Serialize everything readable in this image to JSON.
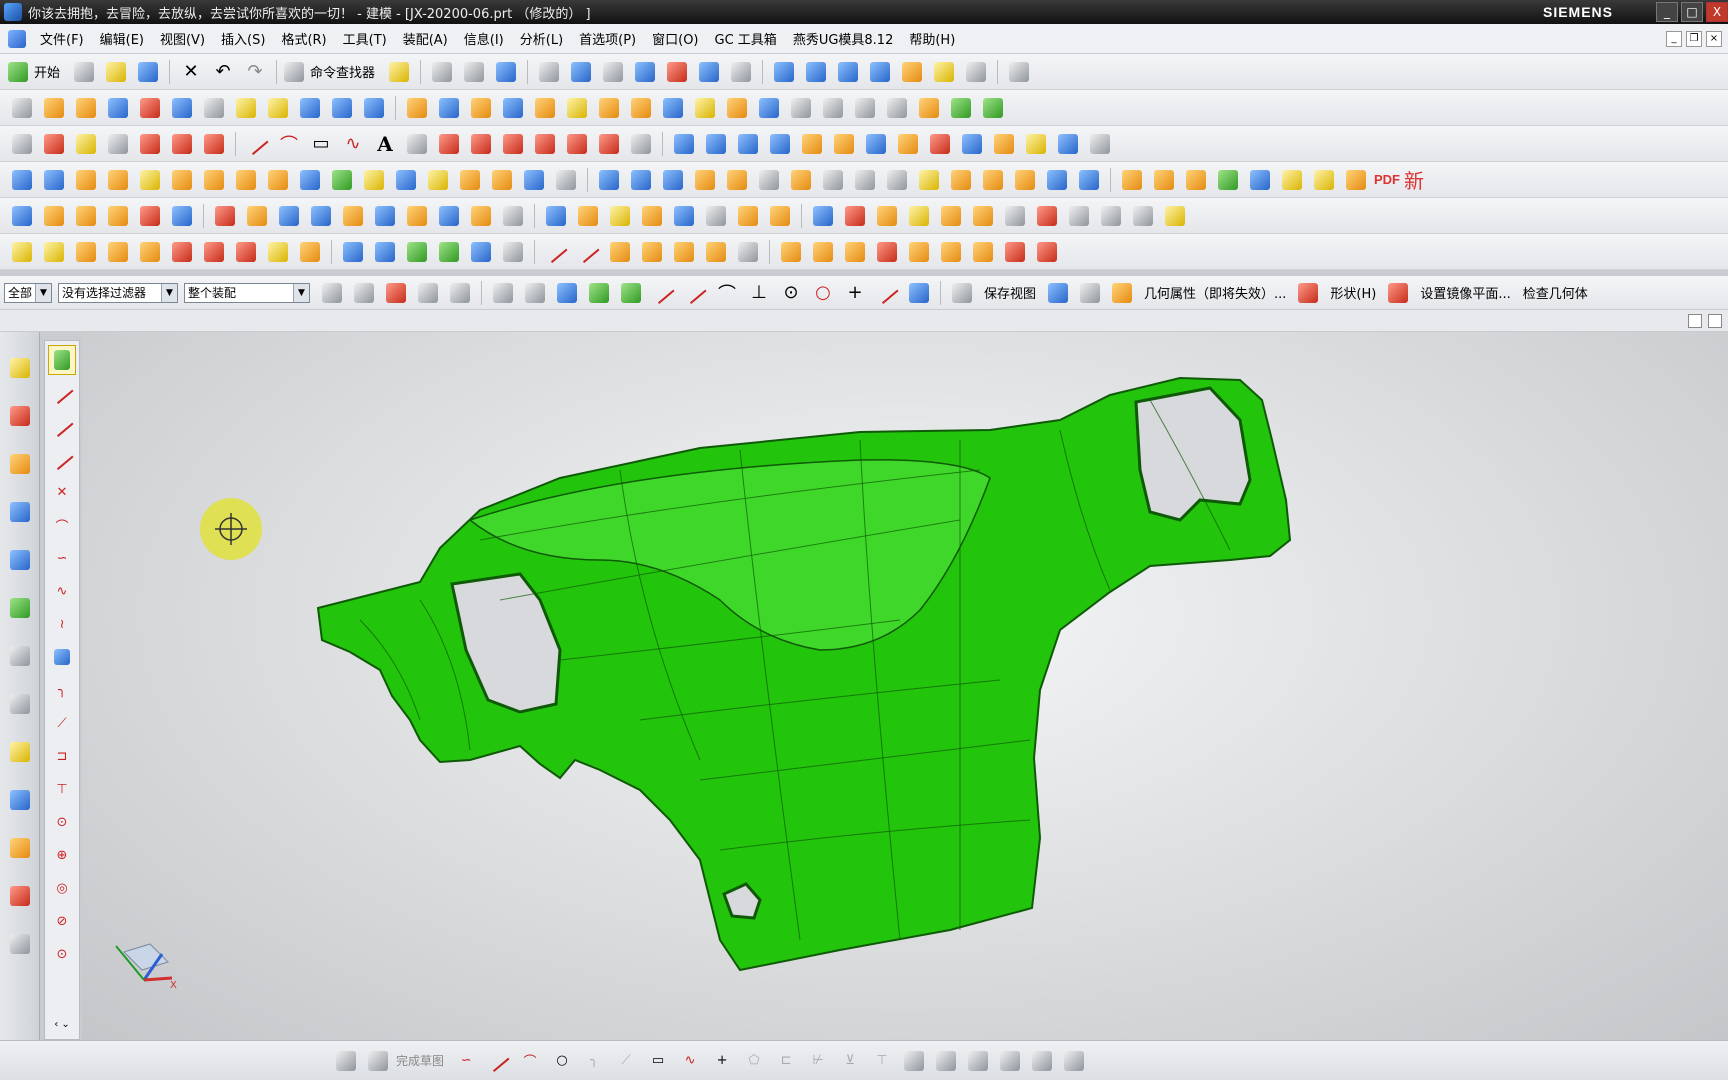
{
  "title_bar": {
    "title": "你该去拥抱，去冒险，去放纵，去尝试你所喜欢的一切！ - 建模 - [JX-20200-06.prt （修改的） ]",
    "brand": "SIEMENS",
    "minimize": "_",
    "maximize": "□",
    "close": "X"
  },
  "menu_bar": {
    "items": [
      "文件(F)",
      "编辑(E)",
      "视图(V)",
      "插入(S)",
      "格式(R)",
      "工具(T)",
      "装配(A)",
      "信息(I)",
      "分析(L)",
      "首选项(P)",
      "窗口(O)",
      "GC 工具箱",
      "燕秀UG模具8.12",
      "帮助(H)"
    ]
  },
  "standard_toolbar": {
    "start_label": "开始",
    "command_finder_label": "命令查找器"
  },
  "right_toolbar": {
    "pdf_label": "PDF",
    "new_label": "新"
  },
  "selection_bar": {
    "type_filter": "全部",
    "selection_filter": "没有选择过滤器",
    "scope": "整个装配",
    "save_view_label": "保存视图",
    "geometry_props_label": "几何属性（即将失效）...",
    "shape_label": "形状(H)",
    "mirror_plane_label": "设置镜像平面...",
    "check_geometry_label": "检查几何体"
  },
  "bottom_bar": {
    "finish_sketch_label": "完成草图"
  },
  "colors": {
    "part_green": "#22c40c",
    "part_edge": "#0f5a06",
    "cursor_yellow": "#e3e23c"
  }
}
